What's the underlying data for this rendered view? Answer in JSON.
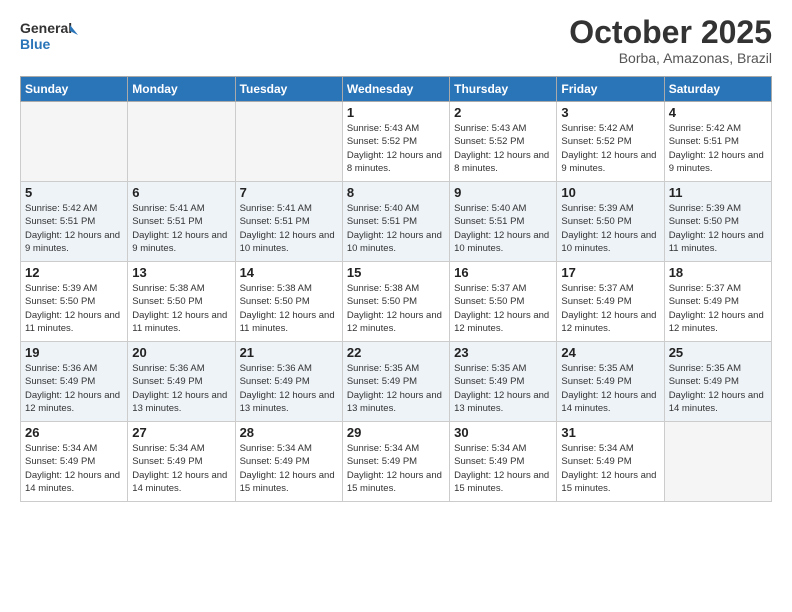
{
  "logo": {
    "line1": "General",
    "line2": "Blue"
  },
  "header": {
    "month": "October 2025",
    "location": "Borba, Amazonas, Brazil"
  },
  "weekdays": [
    "Sunday",
    "Monday",
    "Tuesday",
    "Wednesday",
    "Thursday",
    "Friday",
    "Saturday"
  ],
  "weeks": [
    [
      {
        "day": "",
        "empty": true
      },
      {
        "day": "",
        "empty": true
      },
      {
        "day": "",
        "empty": true
      },
      {
        "day": "1",
        "sunrise": "5:43 AM",
        "sunset": "5:52 PM",
        "daylight": "12 hours and 8 minutes."
      },
      {
        "day": "2",
        "sunrise": "5:43 AM",
        "sunset": "5:52 PM",
        "daylight": "12 hours and 8 minutes."
      },
      {
        "day": "3",
        "sunrise": "5:42 AM",
        "sunset": "5:52 PM",
        "daylight": "12 hours and 9 minutes."
      },
      {
        "day": "4",
        "sunrise": "5:42 AM",
        "sunset": "5:51 PM",
        "daylight": "12 hours and 9 minutes."
      }
    ],
    [
      {
        "day": "5",
        "sunrise": "5:42 AM",
        "sunset": "5:51 PM",
        "daylight": "12 hours and 9 minutes."
      },
      {
        "day": "6",
        "sunrise": "5:41 AM",
        "sunset": "5:51 PM",
        "daylight": "12 hours and 9 minutes."
      },
      {
        "day": "7",
        "sunrise": "5:41 AM",
        "sunset": "5:51 PM",
        "daylight": "12 hours and 10 minutes."
      },
      {
        "day": "8",
        "sunrise": "5:40 AM",
        "sunset": "5:51 PM",
        "daylight": "12 hours and 10 minutes."
      },
      {
        "day": "9",
        "sunrise": "5:40 AM",
        "sunset": "5:51 PM",
        "daylight": "12 hours and 10 minutes."
      },
      {
        "day": "10",
        "sunrise": "5:39 AM",
        "sunset": "5:50 PM",
        "daylight": "12 hours and 10 minutes."
      },
      {
        "day": "11",
        "sunrise": "5:39 AM",
        "sunset": "5:50 PM",
        "daylight": "12 hours and 11 minutes."
      }
    ],
    [
      {
        "day": "12",
        "sunrise": "5:39 AM",
        "sunset": "5:50 PM",
        "daylight": "12 hours and 11 minutes."
      },
      {
        "day": "13",
        "sunrise": "5:38 AM",
        "sunset": "5:50 PM",
        "daylight": "12 hours and 11 minutes."
      },
      {
        "day": "14",
        "sunrise": "5:38 AM",
        "sunset": "5:50 PM",
        "daylight": "12 hours and 11 minutes."
      },
      {
        "day": "15",
        "sunrise": "5:38 AM",
        "sunset": "5:50 PM",
        "daylight": "12 hours and 12 minutes."
      },
      {
        "day": "16",
        "sunrise": "5:37 AM",
        "sunset": "5:50 PM",
        "daylight": "12 hours and 12 minutes."
      },
      {
        "day": "17",
        "sunrise": "5:37 AM",
        "sunset": "5:49 PM",
        "daylight": "12 hours and 12 minutes."
      },
      {
        "day": "18",
        "sunrise": "5:37 AM",
        "sunset": "5:49 PM",
        "daylight": "12 hours and 12 minutes."
      }
    ],
    [
      {
        "day": "19",
        "sunrise": "5:36 AM",
        "sunset": "5:49 PM",
        "daylight": "12 hours and 12 minutes."
      },
      {
        "day": "20",
        "sunrise": "5:36 AM",
        "sunset": "5:49 PM",
        "daylight": "12 hours and 13 minutes."
      },
      {
        "day": "21",
        "sunrise": "5:36 AM",
        "sunset": "5:49 PM",
        "daylight": "12 hours and 13 minutes."
      },
      {
        "day": "22",
        "sunrise": "5:35 AM",
        "sunset": "5:49 PM",
        "daylight": "12 hours and 13 minutes."
      },
      {
        "day": "23",
        "sunrise": "5:35 AM",
        "sunset": "5:49 PM",
        "daylight": "12 hours and 13 minutes."
      },
      {
        "day": "24",
        "sunrise": "5:35 AM",
        "sunset": "5:49 PM",
        "daylight": "12 hours and 14 minutes."
      },
      {
        "day": "25",
        "sunrise": "5:35 AM",
        "sunset": "5:49 PM",
        "daylight": "12 hours and 14 minutes."
      }
    ],
    [
      {
        "day": "26",
        "sunrise": "5:34 AM",
        "sunset": "5:49 PM",
        "daylight": "12 hours and 14 minutes."
      },
      {
        "day": "27",
        "sunrise": "5:34 AM",
        "sunset": "5:49 PM",
        "daylight": "12 hours and 14 minutes."
      },
      {
        "day": "28",
        "sunrise": "5:34 AM",
        "sunset": "5:49 PM",
        "daylight": "12 hours and 15 minutes."
      },
      {
        "day": "29",
        "sunrise": "5:34 AM",
        "sunset": "5:49 PM",
        "daylight": "12 hours and 15 minutes."
      },
      {
        "day": "30",
        "sunrise": "5:34 AM",
        "sunset": "5:49 PM",
        "daylight": "12 hours and 15 minutes."
      },
      {
        "day": "31",
        "sunrise": "5:34 AM",
        "sunset": "5:49 PM",
        "daylight": "12 hours and 15 minutes."
      },
      {
        "day": "",
        "empty": true
      }
    ]
  ]
}
